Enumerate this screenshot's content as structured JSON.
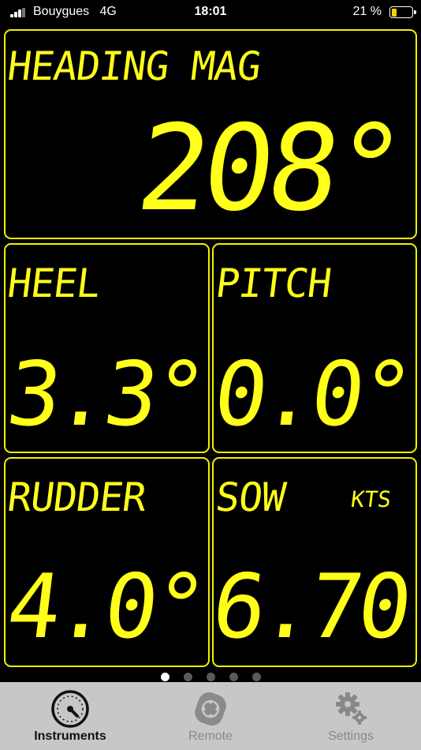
{
  "status": {
    "carrier": "Bouygues",
    "network": "4G",
    "time": "18:01",
    "battery": "21 %"
  },
  "panels": {
    "heading": {
      "label": "HEADING MAG",
      "value": "208°"
    },
    "heel": {
      "label": "HEEL",
      "value": "3.3°"
    },
    "pitch": {
      "label": "PITCH",
      "value": "0.0°"
    },
    "rudder": {
      "label": "RUDDER",
      "value": "4.0°"
    },
    "sow": {
      "label": "SOW",
      "unit": "KTS",
      "value": "6.70"
    }
  },
  "pager": {
    "pages": 5,
    "current": 1
  },
  "tabs": [
    {
      "label": "Instruments",
      "icon": "gauge-icon"
    },
    {
      "label": "Remote",
      "icon": "remote-icon"
    },
    {
      "label": "Settings",
      "icon": "gears-icon"
    }
  ],
  "colors": {
    "display_yellow": "#ffff1a",
    "panel_border": "#f2f200",
    "background": "#000000",
    "tabbar": "#c7c7c7"
  }
}
